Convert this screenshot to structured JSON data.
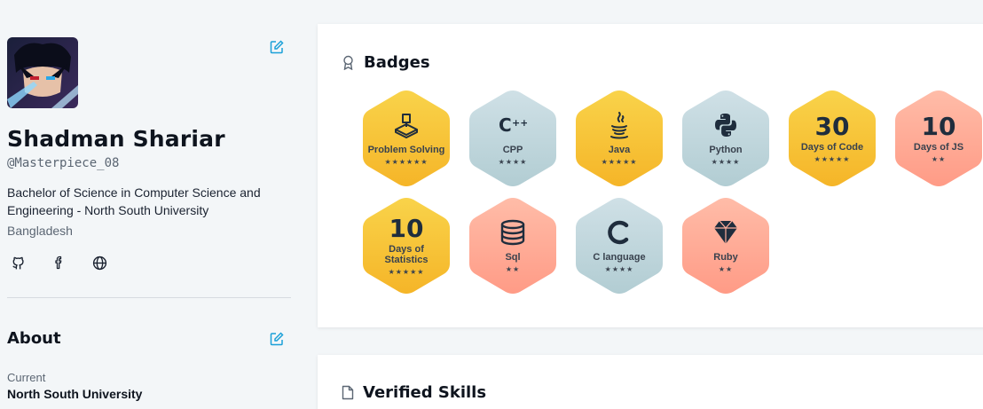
{
  "profile": {
    "name": "Shadman Shariar",
    "handle": "@Masterpiece_08",
    "degree": "Bachelor of Science in Computer Science and Engineering - North South University",
    "location": "Bangladesh",
    "socials": [
      "github-icon",
      "facebook-icon",
      "globe-icon"
    ]
  },
  "about": {
    "title": "About",
    "current_label": "Current",
    "current_value": "North South University"
  },
  "badges": {
    "title": "Badges",
    "items": [
      {
        "label": "Problem Solving",
        "stars": "★★★★★★",
        "color": "gold",
        "icon": "problem-solving-icon"
      },
      {
        "label": "CPP",
        "stars": "★★★★",
        "color": "silver",
        "icon": "cpp-icon"
      },
      {
        "label": "Java",
        "stars": "★★★★★",
        "color": "gold",
        "icon": "java-icon"
      },
      {
        "label": "Python",
        "stars": "★★★★",
        "color": "silver",
        "icon": "python-icon"
      },
      {
        "number": "30",
        "label": "Days of Code",
        "stars": "★★★★★",
        "color": "gold"
      },
      {
        "number": "10",
        "label": "Days of JS",
        "stars": "★★",
        "color": "bronze"
      },
      {
        "number": "10",
        "label": "Days of Statistics",
        "stars": "★★★★★",
        "color": "gold"
      },
      {
        "label": "Sql",
        "stars": "★★",
        "color": "bronze",
        "icon": "database-icon"
      },
      {
        "label": "C language",
        "stars": "★★★★",
        "color": "silver",
        "icon": "c-letter-icon"
      },
      {
        "label": "Ruby",
        "stars": "★★",
        "color": "bronze",
        "icon": "ruby-icon"
      }
    ]
  },
  "skills": {
    "title": "Verified Skills"
  },
  "colors": {
    "gold": "#f8c638",
    "silver": "#c7dbe0",
    "bronze": "#ffae9b",
    "accent": "#1ba0d8"
  }
}
